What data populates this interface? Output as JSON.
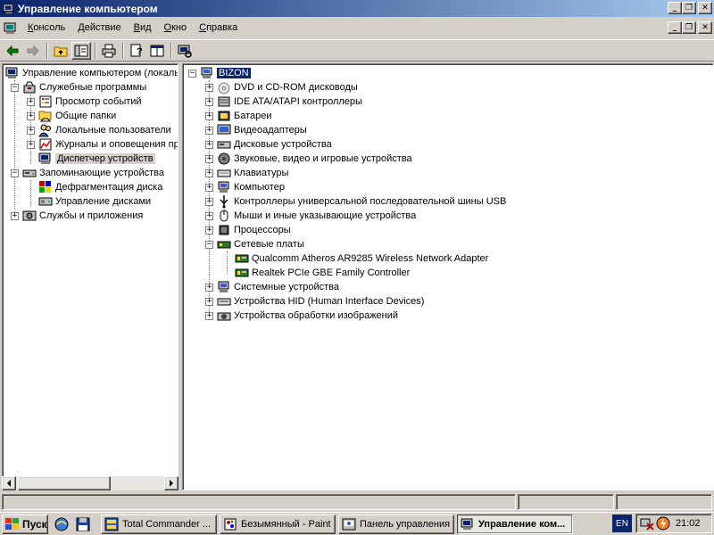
{
  "window": {
    "title": "Управление компьютером",
    "title_buttons": {
      "minimize": "_",
      "restore": "❐",
      "close": "✕"
    }
  },
  "menu": {
    "items": [
      "Консоль",
      "Действие",
      "Вид",
      "Окно",
      "Справка"
    ],
    "underline": [
      "К",
      "Д",
      "В",
      "О",
      "С"
    ],
    "child_buttons": {
      "minimize": "_",
      "restore": "❐",
      "close": "✕"
    }
  },
  "toolbar": {
    "buttons": [
      "back-icon",
      "forward-icon",
      "up-folder-icon",
      "show-tree-icon",
      "print-icon",
      "properties-icon",
      "help-icon",
      "scan-hardware-icon"
    ]
  },
  "tree": {
    "root": "Управление компьютером (локаль",
    "system_tools": "Служебные программы",
    "event_viewer": "Просмотр событий",
    "shared_folders": "Общие папки",
    "local_users": "Локальные пользователи",
    "logs_alerts": "Журналы и оповещения пр",
    "device_manager": "Диспетчер устройств",
    "storage": "Запоминающие устройства",
    "defrag": "Дефрагментация диска",
    "disk_mgmt": "Управление дисками",
    "services": "Службы и приложения"
  },
  "devices": {
    "computer_name": "BIZON",
    "categories": [
      "DVD и CD-ROM дисководы",
      "IDE ATA/ATAPI контроллеры",
      "Батареи",
      "Видеоадаптеры",
      "Дисковые устройства",
      "Звуковые, видео и игровые устройства",
      "Клавиатуры",
      "Компьютер",
      "Контроллеры универсальной последовательной шины USB",
      "Мыши и иные указывающие устройства",
      "Процессоры",
      "Сетевые платы"
    ],
    "network_children": [
      "Qualcomm Atheros AR9285 Wireless Network Adapter",
      "Realtek PCIe GBE Family Controller"
    ],
    "after": [
      "Системные устройства",
      "Устройства HID (Human Interface Devices)",
      "Устройства обработки изображений"
    ]
  },
  "taskbar": {
    "start": "Пуск",
    "tasks": [
      "Total Commander ...",
      "Безымянный - Paint",
      "Панель управления",
      "Управление ком..."
    ],
    "lang": "EN",
    "clock": "21:02"
  }
}
